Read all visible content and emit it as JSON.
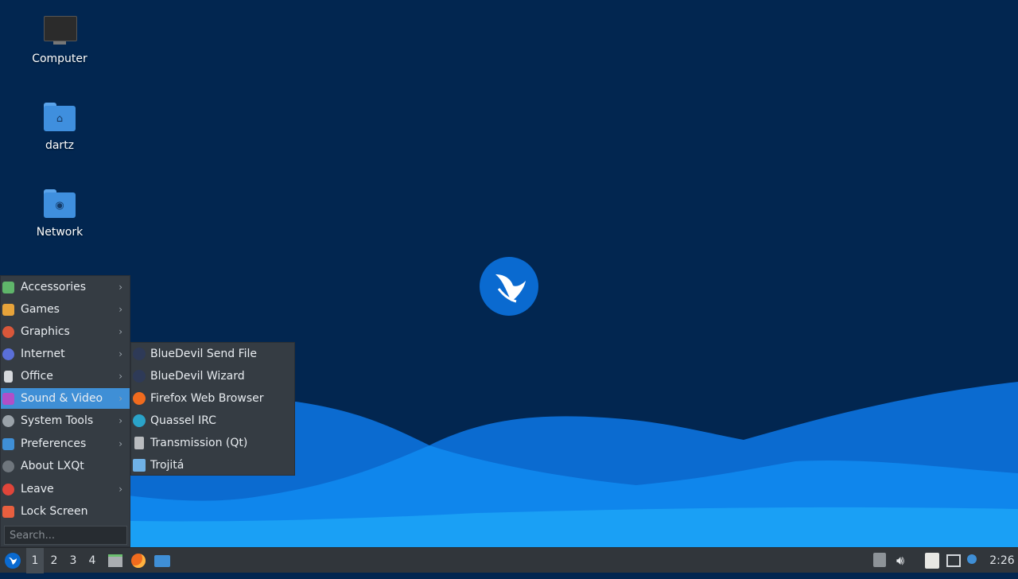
{
  "desktop": {
    "icons": [
      {
        "label": "Computer",
        "icon": "computer-icon"
      },
      {
        "label": "dartz",
        "icon": "home-folder-icon"
      },
      {
        "label": "Network",
        "icon": "network-folder-icon"
      }
    ],
    "logo": "lubuntu-logo"
  },
  "menu": {
    "items": [
      {
        "label": "Accessories",
        "icon": "accessories-icon",
        "color": "#5fb56a",
        "arrow": "›"
      },
      {
        "label": "Games",
        "icon": "games-icon",
        "color": "#e7a33a",
        "arrow": "›"
      },
      {
        "label": "Graphics",
        "icon": "graphics-icon",
        "color": "#d9573a",
        "arrow": "›"
      },
      {
        "label": "Internet",
        "icon": "internet-icon",
        "color": "#5a6fd8",
        "arrow": "›"
      },
      {
        "label": "Office",
        "icon": "office-icon",
        "color": "#d6d9dd",
        "arrow": "›"
      },
      {
        "label": "Sound & Video",
        "icon": "sound-video-icon",
        "color": "#b04fc8",
        "arrow": "›"
      },
      {
        "label": "System Tools",
        "icon": "system-tools-icon",
        "color": "#9aa2a9",
        "arrow": "›"
      },
      {
        "label": "Preferences",
        "icon": "preferences-icon",
        "color": "#3f8fd6",
        "arrow": "›"
      },
      {
        "label": "About LXQt",
        "icon": "info-icon",
        "color": "#6f767d",
        "arrow": ""
      },
      {
        "label": "Leave",
        "icon": "power-icon",
        "color": "#e0453a",
        "arrow": "›"
      },
      {
        "label": "Lock Screen",
        "icon": "lock-icon",
        "color": "#e85f3f",
        "arrow": ""
      }
    ],
    "search_placeholder": "Search..."
  },
  "submenu": {
    "items": [
      {
        "label": "BlueDevil Send File",
        "icon": "bluetooth-icon",
        "color": "#2e3a57"
      },
      {
        "label": "BlueDevil Wizard",
        "icon": "bluetooth-icon",
        "color": "#2e3a57"
      },
      {
        "label": "Firefox Web Browser",
        "icon": "firefox-icon",
        "color": "#f06b1e"
      },
      {
        "label": "Quassel IRC",
        "icon": "quassel-icon",
        "color": "#2aa3c9"
      },
      {
        "label": "Transmission (Qt)",
        "icon": "transmission-icon",
        "color": "#b9bcbf"
      },
      {
        "label": "Trojitá",
        "icon": "trojita-icon",
        "color": "#6fb1e6"
      }
    ]
  },
  "taskbar": {
    "workspaces": [
      "1",
      "2",
      "3",
      "4"
    ],
    "active_workspace": "1",
    "clock": "2:26"
  }
}
